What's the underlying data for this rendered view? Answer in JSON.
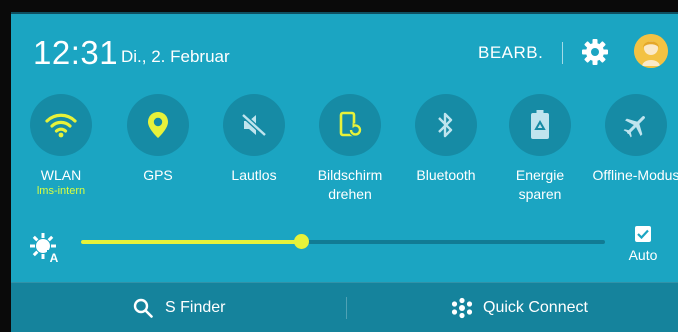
{
  "header": {
    "time": "12:31",
    "date": "Di., 2. Februar",
    "edit_label": "BEARB.",
    "settings_icon": "gear-icon",
    "avatar_icon": "avatar-icon"
  },
  "tiles": [
    {
      "label": "WLAN",
      "sub": "lms-intern",
      "icon": "wifi-icon",
      "active": true
    },
    {
      "label": "GPS",
      "icon": "location-pin-icon",
      "active": true
    },
    {
      "label": "Lautlos",
      "icon": "mute-icon",
      "active": false
    },
    {
      "label": "Bildschirm drehen",
      "icon": "screen-rotate-icon",
      "active": true
    },
    {
      "label": "Bluetooth",
      "icon": "bluetooth-icon",
      "active": false
    },
    {
      "label": "Energie sparen",
      "icon": "battery-saver-icon",
      "active": false
    },
    {
      "label": "Offline-Modus",
      "icon": "airplane-icon",
      "active": false
    }
  ],
  "brightness": {
    "level": 0.42,
    "auto_label": "Auto",
    "auto_checked": true
  },
  "bottom_bar": {
    "s_finder_label": "S Finder",
    "quick_connect_label": "Quick Connect"
  },
  "colors": {
    "panel": "#1ba5c2",
    "tile_bg": "#168ba5",
    "active": "#e7f23a",
    "inactive": "#bfe4ee",
    "bottom_bar": "#15839c"
  }
}
